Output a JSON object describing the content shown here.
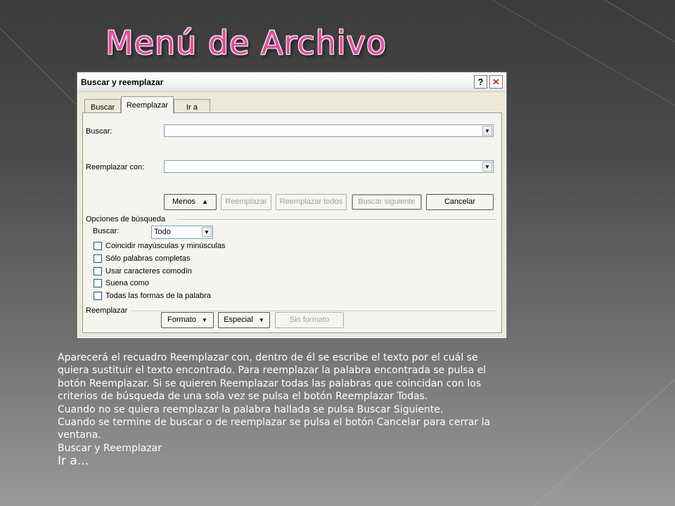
{
  "slide": {
    "title": "Menú de Archivo",
    "paragraphs": [
      "Aparecerá el recuadro Reemplazar con, dentro de él se escribe el texto por el cuál se quiera sustituir el texto encontrado. Para reemplazar la palabra encontrada se pulsa el botón Reemplazar. Si se quieren Reemplazar todas las palabras que coincidan con los criterios de búsqueda de una sola vez se pulsa el botón Reemplazar Todas.",
      "Cuando no se quiera reemplazar la palabra hallada se pulsa Buscar Siguiente.",
      "Cuando se termine de buscar o de reemplazar se pulsa el botón Cancelar para cerrar la ventana.",
      "Buscar y Reemplazar",
      "Ir a..."
    ],
    "colors": {
      "title": "#e0509e",
      "background_top": "#3b3b3b",
      "background_bottom": "#9a9a9a"
    }
  },
  "dialog": {
    "title": "Buscar y reemplazar",
    "help_icon": "?",
    "close_icon": "✕",
    "tabs": [
      "Buscar",
      "Reemplazar",
      "Ir a"
    ],
    "active_tab": "Reemplazar",
    "find_label": "Buscar:",
    "find_value": "",
    "replace_label": "Reemplazar con:",
    "replace_value": "",
    "buttons": {
      "less": "Menos",
      "replace": "Reemplazar",
      "replace_all": "Reemplazar todos",
      "find_next": "Buscar siguiente",
      "cancel": "Cancelar"
    },
    "search_options": {
      "heading": "Opciones de búsqueda",
      "search_label": "Buscar:",
      "search_value": "Todo",
      "checkboxes": [
        "Coincidir mayúsculas y minúsculas",
        "Sólo palabras completas",
        "Usar caracteres comodín",
        "Suena como",
        "Todas las formas de la palabra"
      ]
    },
    "replace_section": {
      "heading": "Reemplazar",
      "format": "Formato",
      "special": "Especial",
      "no_format": "Sin formato"
    }
  }
}
